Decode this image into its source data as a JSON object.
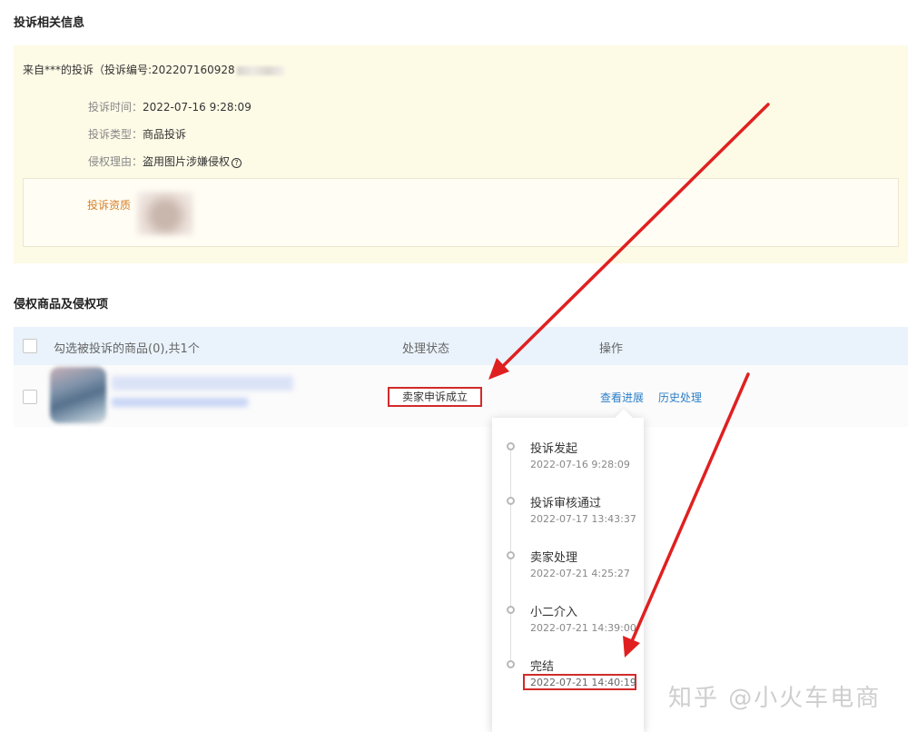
{
  "complaint_section": {
    "title": "投诉相关信息",
    "from_text": "来自***的投诉（投诉编号:202207160928",
    "time_label": "投诉时间：",
    "time_value": "2022-07-16 9:28:09",
    "type_label": "投诉类型：",
    "type_value": "商品投诉",
    "reason_label": "侵权理由：",
    "reason_value": "盗用图片涉嫌侵权",
    "evidence_label": "投诉资质"
  },
  "goods_section": {
    "title": "侵权商品及侵权项",
    "columns": {
      "select": "勾选被投诉的商品(0),共1个",
      "status": "处理状态",
      "action": "操作"
    },
    "row": {
      "status": "卖家申诉成立",
      "view_progress": "查看进展",
      "history": "历史处理"
    }
  },
  "progress_timeline": [
    {
      "title": "投诉发起",
      "time": "2022-07-16 9:28:09"
    },
    {
      "title": "投诉审核通过",
      "time": "2022-07-17 13:43:37"
    },
    {
      "title": "卖家处理",
      "time": "2022-07-21 4:25:27"
    },
    {
      "title": "小二介入",
      "time": "2022-07-21 14:39:00"
    },
    {
      "title": "完结",
      "time": "2022-07-21 14:40:19"
    }
  ],
  "watermark": "知乎 @小火车电商",
  "colors": {
    "info_bg": "#fdfae6",
    "table_header_bg": "#eaf3fb",
    "link": "#2c7fc7",
    "highlight_red": "#d22a2a",
    "evidence_label": "#d77f2a"
  },
  "icons": {
    "question": "question-circle-icon",
    "arrow": "red-arrow-annotation"
  }
}
